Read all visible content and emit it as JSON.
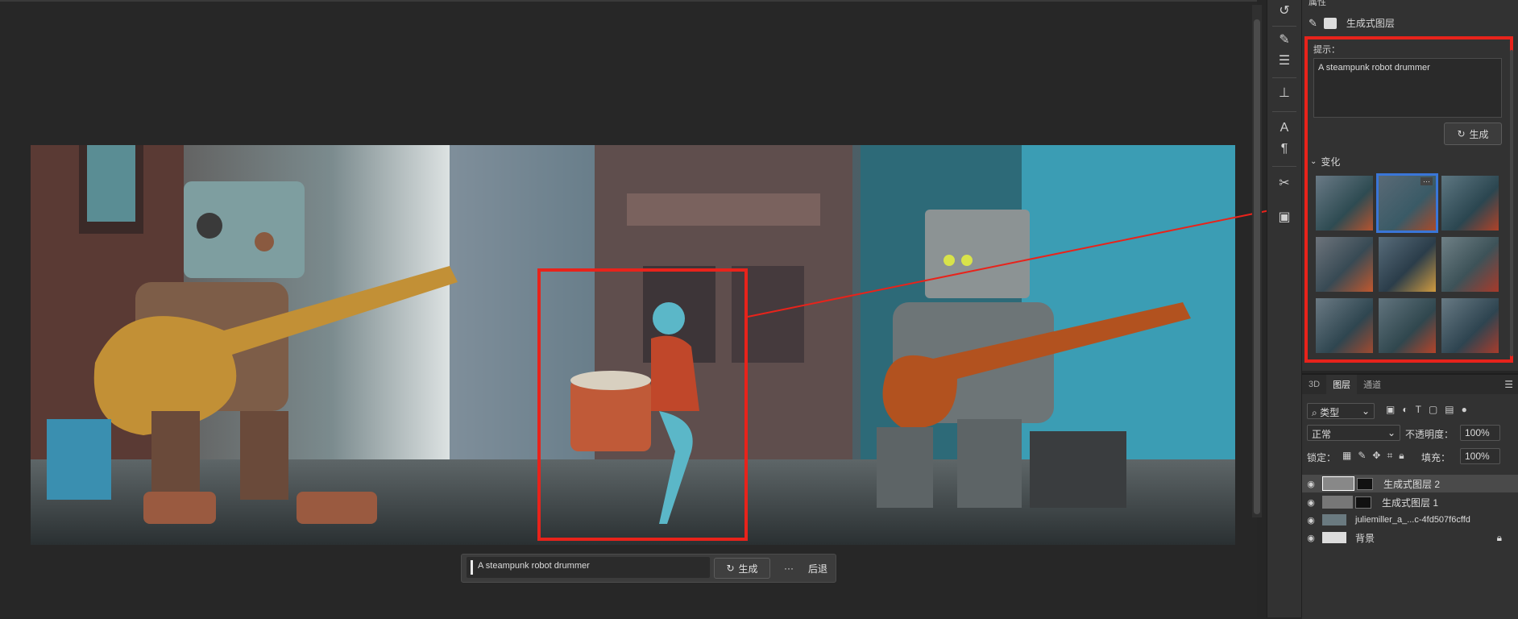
{
  "canvas": {
    "label": "canvas"
  },
  "generate_bar": {
    "prompt": "A steampunk robot drummer",
    "generate_label": "生成",
    "more_label": "···",
    "back_label": "后退"
  },
  "properties": {
    "panel_tab": "属性",
    "layer_type": "生成式图层",
    "prompt_label": "提示：",
    "prompt_value": "A steampunk robot drummer",
    "generate_label": "生成",
    "variations_label": "变化"
  },
  "layers": {
    "tabs": [
      "3D",
      "图层",
      "通道"
    ],
    "kind_label": "类型",
    "blend_mode": "正常",
    "opacity_label": "不透明度：",
    "opacity_value": "100%",
    "lock_label": "锁定：",
    "fill_label": "填充：",
    "fill_value": "100%",
    "items": [
      {
        "name": "生成式图层 2"
      },
      {
        "name": "生成式图层 1"
      },
      {
        "name": "juliemiller_a_...c-4fd507f6cffd"
      },
      {
        "name": "背景"
      }
    ]
  },
  "colors": {
    "accent_red": "#e8231b",
    "selected_blue": "#3a76d8",
    "panel": "#323232"
  }
}
